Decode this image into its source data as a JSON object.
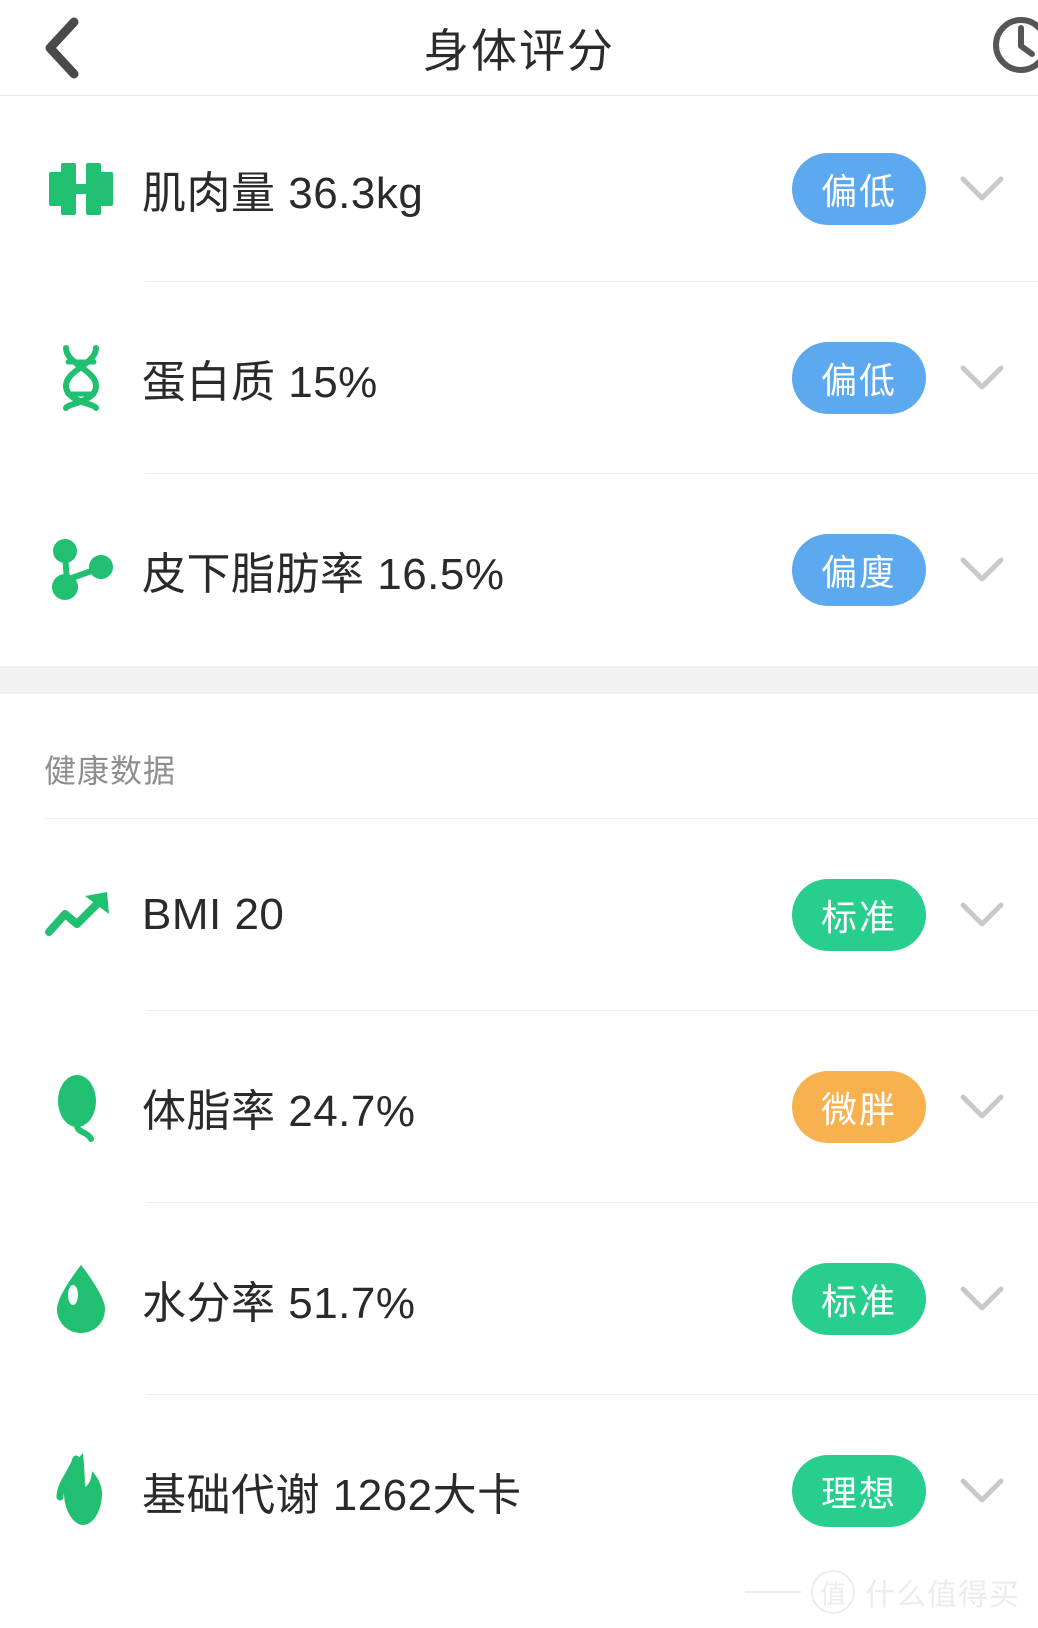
{
  "header": {
    "title": "身体评分",
    "back_icon": "chevron-left-icon",
    "history_icon": "clock-icon"
  },
  "body_composition": {
    "rows": [
      {
        "icon": "dumbbell-icon",
        "label": "肌肉量 36.3kg",
        "metric": "肌肉量",
        "value": "36.3",
        "unit": "kg",
        "badge": "偏低",
        "badge_color": "#5CA9F0",
        "chevron": "chevron-down-icon"
      },
      {
        "icon": "dna-helix-icon",
        "label": "蛋白质 15%",
        "metric": "蛋白质",
        "value": "15",
        "unit": "%",
        "badge": "偏低",
        "badge_color": "#5CA9F0",
        "chevron": "chevron-down-icon"
      },
      {
        "icon": "molecule-icon",
        "label": "皮下脂肪率 16.5%",
        "metric": "皮下脂肪率",
        "value": "16.5",
        "unit": "%",
        "badge": "偏廋",
        "badge_color": "#5CA9F0",
        "chevron": "chevron-down-icon"
      }
    ]
  },
  "health_section": {
    "title": "健康数据",
    "rows": [
      {
        "icon": "trending-up-icon",
        "label": "BMI 20",
        "metric": "BMI",
        "value": "20",
        "unit": "",
        "badge": "标准",
        "badge_color": "#27CE8E",
        "chevron": "chevron-down-icon"
      },
      {
        "icon": "fat-drop-icon",
        "label": "体脂率 24.7%",
        "metric": "体脂率",
        "value": "24.7",
        "unit": "%",
        "badge": "微胖",
        "badge_color": "#F7B24F",
        "chevron": "chevron-down-icon"
      },
      {
        "icon": "water-drop-icon",
        "label": "水分率 51.7%",
        "metric": "水分率",
        "value": "51.7",
        "unit": "%",
        "badge": "标准",
        "badge_color": "#27CE8E",
        "chevron": "chevron-down-icon"
      },
      {
        "icon": "flame-icon",
        "label": "基础代谢 1262大卡",
        "metric": "基础代谢",
        "value": "1262",
        "unit": "大卡",
        "badge": "理想",
        "badge_color": "#27CE8E",
        "chevron": "chevron-down-icon"
      }
    ]
  },
  "watermark": {
    "mark": "值",
    "text": "什么值得买"
  },
  "colors": {
    "accent_green": "#20C070",
    "badge_blue": "#5CA9F0",
    "badge_green": "#27CE8E",
    "badge_orange": "#F7B24F",
    "text_primary": "#2A2A2A",
    "text_muted": "#8E8E8E",
    "divider": "#EEEEEE",
    "section_gap": "#F2F2F2"
  }
}
